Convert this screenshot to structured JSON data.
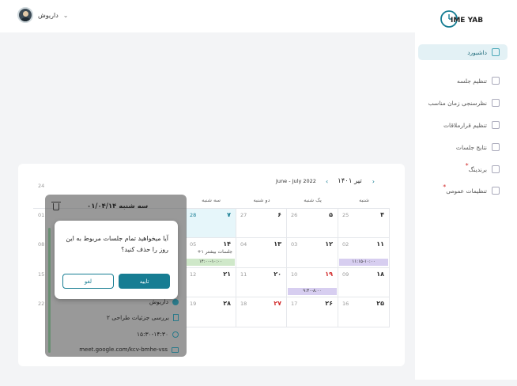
{
  "topbar": {
    "user_name": "داریوش",
    "chevron": "⌄"
  },
  "brand": {
    "logo_text": "TIME YAB",
    "accent": "#177d93"
  },
  "sidebar": {
    "items": [
      {
        "label": "داشبورد",
        "icon": "dashboard-icon",
        "active": true,
        "star": false
      },
      {
        "label": "تنظیم جلسه",
        "icon": "calendar-check-icon",
        "star": false
      },
      {
        "label": "نظرسنجی زمان مناسب",
        "icon": "clipboard-icon",
        "star": false
      },
      {
        "label": "تنظیم قرارملاقات",
        "icon": "users-icon",
        "star": false
      },
      {
        "label": "نتایج جلسات",
        "icon": "report-icon",
        "star": false
      },
      {
        "label": "برندینگ",
        "icon": "building-icon",
        "star": true
      },
      {
        "label": "تنظیمات عمومی",
        "icon": "gear-icon",
        "star": true
      }
    ]
  },
  "calendar": {
    "month_fa": "تیر ۱۴۰۱",
    "month_en": "June - July 2022",
    "weekdays": [
      "شنبه",
      "یک شنبه",
      "دو شنبه",
      "سه شنبه"
    ],
    "weeks": [
      [
        {
          "fa": "۴",
          "en": "25"
        },
        {
          "fa": "۵",
          "en": "26"
        },
        {
          "fa": "۶",
          "en": "27"
        },
        {
          "fa": "۷",
          "en": "28",
          "today": true
        }
      ],
      [
        {
          "fa": "۱۱",
          "en": "02",
          "event": "۱۱:۱۵-۱۰:۰۰"
        },
        {
          "fa": "۱۲",
          "en": "03"
        },
        {
          "fa": "۱۳",
          "en": "04"
        },
        {
          "fa": "۱۴",
          "en": "05",
          "more": "+۱ جلسات بیشتر",
          "event": "۱۴:۰۰-۱۰:۰۰"
        }
      ],
      [
        {
          "fa": "۱۸",
          "en": "09"
        },
        {
          "fa": "۱۹",
          "en": "10",
          "holiday": true,
          "event": "۹:۳۰-۸:۰۰"
        },
        {
          "fa": "۲۰",
          "en": "11"
        },
        {
          "fa": "۲۱",
          "en": "12"
        }
      ],
      [
        {
          "fa": "۲۵",
          "en": "16"
        },
        {
          "fa": "۲۶",
          "en": "17"
        },
        {
          "fa": "۲۷",
          "en": "18",
          "holiday": true
        },
        {
          "fa": "۲۸",
          "en": "19"
        }
      ]
    ],
    "left_edge_numbers": [
      "24",
      "01",
      "08",
      "15",
      "22"
    ]
  },
  "day_panel": {
    "title": "سه شنبه ۰۱/۰۴/۱۴",
    "host": "داریوش",
    "meeting_title": "بررسی جزئیات طراحی ۲",
    "time": "۱۵:۳۰-۱۴:۳۰",
    "link": "meet.google.com/kcv-bmhe-vss"
  },
  "dialog": {
    "message": "آیا میخواهید تمام جلسات مربوط به این روز را حذف کنید؟",
    "confirm": "تایید",
    "cancel": "لغو"
  }
}
